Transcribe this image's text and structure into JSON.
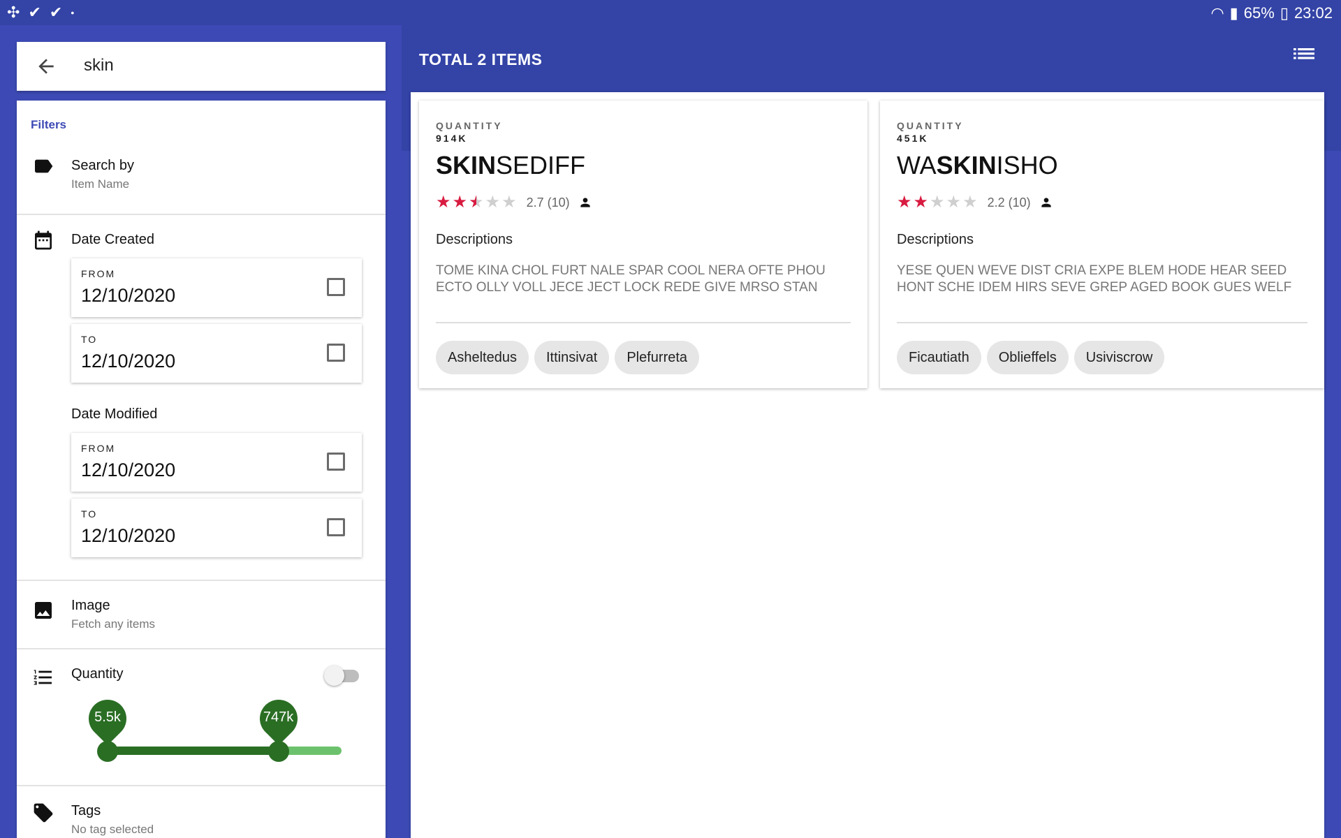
{
  "status_bar": {
    "battery": "65%",
    "time": "23:02"
  },
  "search": {
    "query": "skin"
  },
  "filters": {
    "title": "Filters",
    "search_by": {
      "title": "Search by",
      "subtitle": "Item Name"
    },
    "date_created": {
      "title": "Date Created",
      "from_label": "FROM",
      "from_value": "12/10/2020",
      "to_label": "TO",
      "to_value": "12/10/2020"
    },
    "date_modified": {
      "title": "Date Modified",
      "from_label": "FROM",
      "from_value": "12/10/2020",
      "to_label": "TO",
      "to_value": "12/10/2020"
    },
    "image": {
      "title": "Image",
      "subtitle": "Fetch any items"
    },
    "quantity": {
      "title": "Quantity",
      "toggle_on": false,
      "range_min_label": "5.5k",
      "range_max_label": "747k",
      "range_min_fraction": 0.0,
      "range_max_fraction": 0.73
    },
    "tags": {
      "title": "Tags",
      "subtitle": "No tag selected"
    }
  },
  "header": {
    "title": "TOTAL 2 ITEMS",
    "menu_icon": "list-view-icon"
  },
  "items": [
    {
      "quantity_label": "QUANTITY",
      "quantity_value": "914K",
      "name_match": "SKIN",
      "name_rest": "SEDIFF",
      "rating": 2.7,
      "rating_text": "2.7 (10)",
      "descriptions_label": "Descriptions",
      "description": "TOME KINA CHOL FURT NALE SPAR COOL NERA OFTE PHOU ECTO OLLY VOLL JECE JECT LOCK REDE GIVE MRSO STAN",
      "tags": [
        "Asheltedus",
        "Ittinsivat",
        "Plefurreta"
      ]
    },
    {
      "quantity_label": "QUANTITY",
      "quantity_value": "451K",
      "name_prefix": "WA",
      "name_match": "SKIN",
      "name_rest": "ISHO",
      "rating": 2.2,
      "rating_text": "2.2 (10)",
      "descriptions_label": "Descriptions",
      "description": "YESE QUEN WEVE DIST CRIA EXPE BLEM HODE HEAR SEED HONT SCHE IDEM HIRS SEVE GREP AGED BOOK GUES WELF",
      "tags": [
        "Ficautiath",
        "Oblieffels",
        "Usiviscrow"
      ]
    }
  ],
  "colors": {
    "primary": "#3d4ab5",
    "star": "#d81b40",
    "slider": "#2a6e24"
  }
}
